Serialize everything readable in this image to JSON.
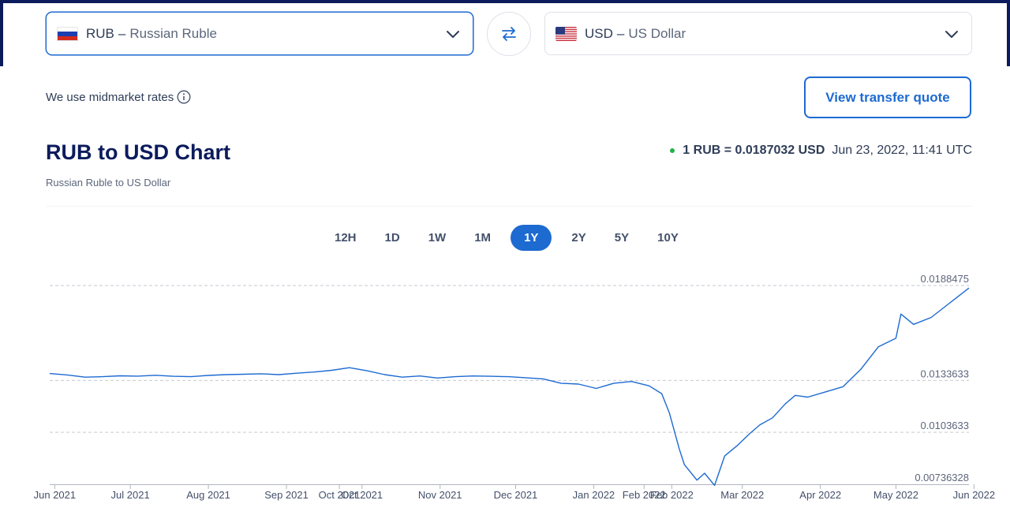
{
  "from": {
    "code": "RUB",
    "name": "Russian Ruble"
  },
  "to": {
    "code": "USD",
    "name": "US Dollar"
  },
  "dash": "–",
  "midmarket_text": "We use midmarket rates",
  "quote_button": "View transfer quote",
  "title": "RUB to USD Chart",
  "subtitle": "Russian Ruble to US Dollar",
  "rate": {
    "value": "1 RUB = 0.0187032 USD",
    "time": "Jun 23, 2022, 11:41 UTC"
  },
  "ranges": [
    "12H",
    "1D",
    "1W",
    "1M",
    "1Y",
    "2Y",
    "5Y",
    "10Y"
  ],
  "selected_range": "1Y",
  "colors": {
    "accent": "#1d6ad1",
    "title": "#0b1b5c",
    "live": "#21b24b"
  },
  "chart_data": {
    "type": "line",
    "series": [
      {
        "x": [
          "2021-06-23",
          "2021-06-30",
          "2021-07-07",
          "2021-07-14",
          "2021-07-21",
          "2021-07-28",
          "2021-08-04",
          "2021-08-11",
          "2021-08-18",
          "2021-08-25",
          "2021-09-01",
          "2021-09-08",
          "2021-09-15",
          "2021-09-22",
          "2021-09-29",
          "2021-10-06",
          "2021-10-13",
          "2021-10-20",
          "2021-10-27",
          "2021-11-03",
          "2021-11-10",
          "2021-11-17",
          "2021-11-24",
          "2021-12-01",
          "2021-12-08",
          "2021-12-15",
          "2021-12-22",
          "2021-12-29",
          "2022-01-05",
          "2022-01-12",
          "2022-01-19",
          "2022-01-26",
          "2022-02-02",
          "2022-02-09",
          "2022-02-16",
          "2022-02-21",
          "2022-02-24",
          "2022-02-28",
          "2022-03-02",
          "2022-03-07",
          "2022-03-10",
          "2022-03-14",
          "2022-03-18",
          "2022-03-23",
          "2022-03-28",
          "2022-04-01",
          "2022-04-06",
          "2022-04-11",
          "2022-04-15",
          "2022-04-20",
          "2022-04-27",
          "2022-05-04",
          "2022-05-11",
          "2022-05-18",
          "2022-05-25",
          "2022-05-27",
          "2022-06-01",
          "2022-06-08",
          "2022-06-15",
          "2022-06-23"
        ],
        "y": [
          0.01376,
          0.01368,
          0.01355,
          0.01358,
          0.01363,
          0.01361,
          0.01366,
          0.0136,
          0.01358,
          0.01365,
          0.0137,
          0.01372,
          0.01375,
          0.0137,
          0.01378,
          0.01385,
          0.01395,
          0.0141,
          0.01392,
          0.0137,
          0.01355,
          0.01362,
          0.0135,
          0.01358,
          0.01362,
          0.0136,
          0.01358,
          0.01352,
          0.01345,
          0.0132,
          0.01315,
          0.0129,
          0.0132,
          0.0133,
          0.01305,
          0.0126,
          0.0115,
          0.0094,
          0.0085,
          0.0076,
          0.008,
          0.0073,
          0.009,
          0.0096,
          0.0103,
          0.0108,
          0.0112,
          0.012,
          0.0125,
          0.0124,
          0.0127,
          0.013,
          0.014,
          0.0153,
          0.0158,
          0.0172,
          0.0166,
          0.017,
          0.0178,
          0.0187
        ]
      }
    ],
    "x_tick_labels": [
      "Jun 2021",
      "Jul 2021",
      "Aug 2021",
      "Sep 2021",
      "Oct 2021",
      "Oct 2021",
      "Nov 2021",
      "Dec 2021",
      "Jan 2022",
      "Feb 2022",
      "Feb 2022",
      "Mar 2022",
      "Apr 2022",
      "May 2022",
      "Jun 2022"
    ],
    "x_ticks": [
      "2021-06-25",
      "2021-07-25",
      "2021-08-25",
      "2021-09-25",
      "2021-10-16",
      "2021-10-25",
      "2021-11-25",
      "2021-12-25",
      "2022-01-25",
      "2022-02-14",
      "2022-02-25",
      "2022-03-25",
      "2022-04-25",
      "2022-05-25",
      "2022-06-25"
    ],
    "y_ticks": [
      0.0188475,
      0.0133633,
      0.0103633,
      0.00736328
    ],
    "y_tick_labels": [
      "0.0188475",
      "0.0133633",
      "0.0103633",
      "0.00736328"
    ],
    "ylim": [
      0.00736328,
      0.0188475
    ],
    "xlim": [
      "2021-06-23",
      "2022-06-23"
    ],
    "grid": true,
    "color": "#1d6ad1"
  }
}
